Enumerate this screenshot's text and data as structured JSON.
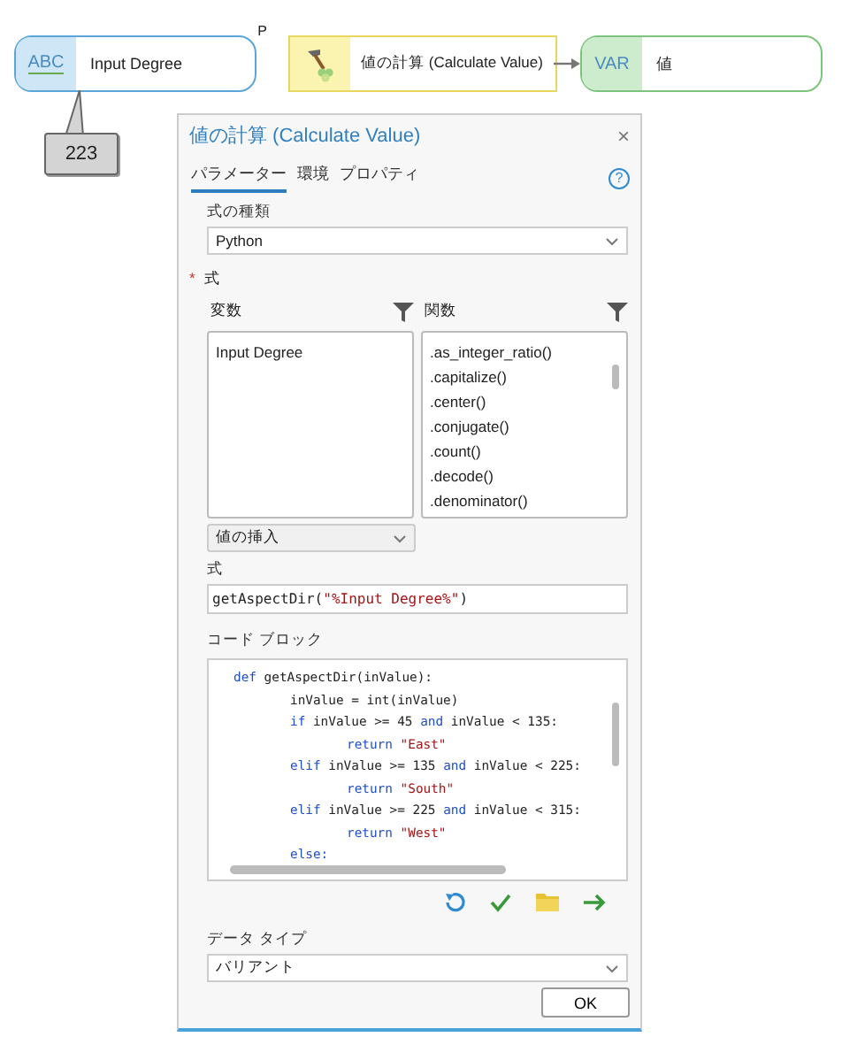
{
  "model": {
    "nodes": [
      {
        "kind": "variable",
        "type_label": "ABC",
        "label": "Input Degree",
        "color": "#5aa6d8",
        "parameter_mark": "P",
        "value_tag": "223"
      },
      {
        "kind": "tool",
        "label": "値の計算 (Calculate Value)",
        "color": "#e8d860"
      },
      {
        "kind": "output",
        "type_label": "VAR",
        "label": "値",
        "color": "#7cc47c"
      }
    ]
  },
  "dialog": {
    "title": "値の計算 (Calculate Value)",
    "close": "×",
    "help": "?",
    "tabs": [
      {
        "label": "パラメーター",
        "selected": true
      },
      {
        "label": "環境",
        "selected": false
      },
      {
        "label": "プロパティ",
        "selected": false
      }
    ],
    "expression_type": {
      "label": "式の種類",
      "value": "Python"
    },
    "expression_section": {
      "required_mark": "*",
      "label": "式"
    },
    "variables": {
      "label": "変数",
      "items": [
        "Input Degree"
      ]
    },
    "functions": {
      "label": "関数",
      "items": [
        ".as_integer_ratio()",
        ".capitalize()",
        ".center()",
        ".conjugate()",
        ".count()",
        ".decode()",
        ".denominator()"
      ]
    },
    "insert_value": {
      "value": "値の挿入"
    },
    "expression": {
      "label": "式",
      "tokens": [
        {
          "kind": "plain",
          "text": "getAspectDir("
        },
        {
          "kind": "string",
          "text": "\"%Input Degree%\""
        },
        {
          "kind": "plain",
          "text": ")"
        }
      ]
    },
    "code_block": {
      "label": "コード ブロック",
      "lines": [
        {
          "tokens": [
            {
              "kind": "keyword",
              "text": "def"
            },
            {
              "kind": "plain",
              "text": " getAspectDir(inValue):"
            }
          ],
          "children": [
            {
              "tokens": [
                {
                  "kind": "plain",
                  "text": "inValue = int(inValue)"
                }
              ]
            },
            {
              "tokens": [
                {
                  "kind": "keyword",
                  "text": "if"
                },
                {
                  "kind": "plain",
                  "text": " inValue >= 45 "
                },
                {
                  "kind": "keyword",
                  "text": "and"
                },
                {
                  "kind": "plain",
                  "text": " inValue < 135:"
                }
              ],
              "children": [
                {
                  "tokens": [
                    {
                      "kind": "keyword",
                      "text": "return"
                    },
                    {
                      "kind": "string",
                      "text": " \"East\""
                    }
                  ]
                }
              ]
            },
            {
              "tokens": [
                {
                  "kind": "keyword",
                  "text": "elif"
                },
                {
                  "kind": "plain",
                  "text": " inValue >= 135 "
                },
                {
                  "kind": "keyword",
                  "text": "and"
                },
                {
                  "kind": "plain",
                  "text": " inValue < 225:"
                }
              ],
              "children": [
                {
                  "tokens": [
                    {
                      "kind": "keyword",
                      "text": "return"
                    },
                    {
                      "kind": "string",
                      "text": " \"South\""
                    }
                  ]
                }
              ]
            },
            {
              "tokens": [
                {
                  "kind": "keyword",
                  "text": "elif"
                },
                {
                  "kind": "plain",
                  "text": " inValue >= 225 "
                },
                {
                  "kind": "keyword",
                  "text": "and"
                },
                {
                  "kind": "plain",
                  "text": " inValue < 315:"
                }
              ],
              "children": [
                {
                  "tokens": [
                    {
                      "kind": "keyword",
                      "text": "return"
                    },
                    {
                      "kind": "string",
                      "text": " \"West\""
                    }
                  ]
                }
              ]
            },
            {
              "tokens": [
                {
                  "kind": "keyword",
                  "text": "else:"
                }
              ]
            }
          ]
        }
      ]
    },
    "data_type": {
      "label": "データ タイプ",
      "value": "バリアント"
    },
    "ok_button": "OK"
  }
}
